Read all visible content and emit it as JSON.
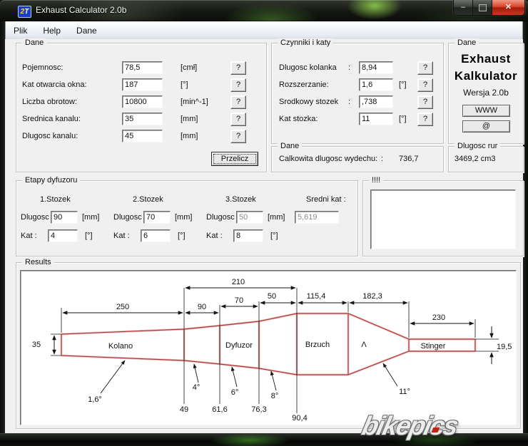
{
  "window": {
    "title": "Exhaust Calculator 2.0b",
    "icon": {
      "c1": "2",
      "c2": "T"
    },
    "buttons": {
      "minimize": "–",
      "close": "✕"
    }
  },
  "menu": {
    "items": [
      "Plik",
      "Help",
      "Dane"
    ]
  },
  "dane_inputs": {
    "title": "Dane",
    "rows": [
      {
        "label": "Pojemnosc:",
        "value": "78,5",
        "unit": "[cmł]",
        "help": "?"
      },
      {
        "label": "Kat otwarcia okna:",
        "value": "187",
        "unit": "[°]",
        "help": "?"
      },
      {
        "label": "Liczba obrotow:",
        "value": "10800",
        "unit": "[min^-1]",
        "help": "?"
      },
      {
        "label": "Srednica kanalu:",
        "value": "35",
        "unit": "[mm]",
        "help": "?"
      },
      {
        "label": "Dlugosc kanalu:",
        "value": "45",
        "unit": "[mm]",
        "help": "?"
      }
    ],
    "submit": "Przelicz"
  },
  "czynniki": {
    "title": "Czynniki i katy",
    "rows": [
      {
        "label": "Dlugosc kolanka",
        "colon": ":",
        "value": "8,94",
        "unit": "",
        "help": "?"
      },
      {
        "label": "Rozszerzanie:",
        "colon": "",
        "value": "1,6",
        "unit": "[°]",
        "help": "?"
      },
      {
        "label": "Srodkowy stozek",
        "colon": ":",
        "value": ",738",
        "unit": "",
        "help": "?"
      },
      {
        "label": "Kat stozka:",
        "colon": "",
        "value": "11",
        "unit": "[°]",
        "help": "?"
      }
    ]
  },
  "dane_total": {
    "title": "Dane",
    "label": "Calkowita dlugosc wydechu:",
    "colon": ":",
    "value": "736,7"
  },
  "about": {
    "title": "Dane",
    "name1": "Exhaust",
    "name2": "Kalkulator",
    "version": "Wersja  2.0b",
    "www": "WWW",
    "email": "@"
  },
  "pipes": {
    "title": "Dlugosc rur",
    "value": "3469,2 cm3"
  },
  "etapy": {
    "title": "Etapy dyfuzoru",
    "dlugosc_label": "Dlugosc",
    "kat_label": "Kat :",
    "mm": "[mm]",
    "deg": "[°]",
    "cones": [
      {
        "header": "1.Stozek",
        "dlugosc": "90",
        "kat": "4"
      },
      {
        "header": "2.Stozek",
        "dlugosc": "70",
        "kat": "6"
      },
      {
        "header": "3.Stozek",
        "dlugosc": "50",
        "kat": "8"
      }
    ],
    "sredni": {
      "header": "Sredni kat :",
      "value": "5,619"
    }
  },
  "alerts": {
    "title": "!!!!"
  },
  "results": {
    "title": "Results",
    "diagram": {
      "section_labels": {
        "kolano": "Kolano",
        "dyfuzor": "Dyfuzor",
        "brzuch": "Brzuch",
        "cone": "Λ",
        "stinger": "Stinger"
      },
      "lengths": {
        "l250": "250",
        "l90": "90",
        "l70": "70",
        "l210": "210",
        "l50": "50",
        "l115": "115,4",
        "l182": "182,3",
        "l230": "230"
      },
      "diameters": {
        "d35": "35",
        "d49": "49",
        "d61": "61,6",
        "d76": "76,3",
        "d90": "90,4",
        "d19": "19,5"
      },
      "angles": {
        "a1": "1,6°",
        "a2": "4°",
        "a3": "6°",
        "a4": "8°",
        "a5": "11°"
      }
    }
  },
  "watermark": {
    "left": "bikepi",
    "accent": "c",
    "right": "s"
  },
  "colors": {
    "pipe_red": "#a93636",
    "close_red": "#c23a1f",
    "client_bg": "#f0f0f0"
  }
}
